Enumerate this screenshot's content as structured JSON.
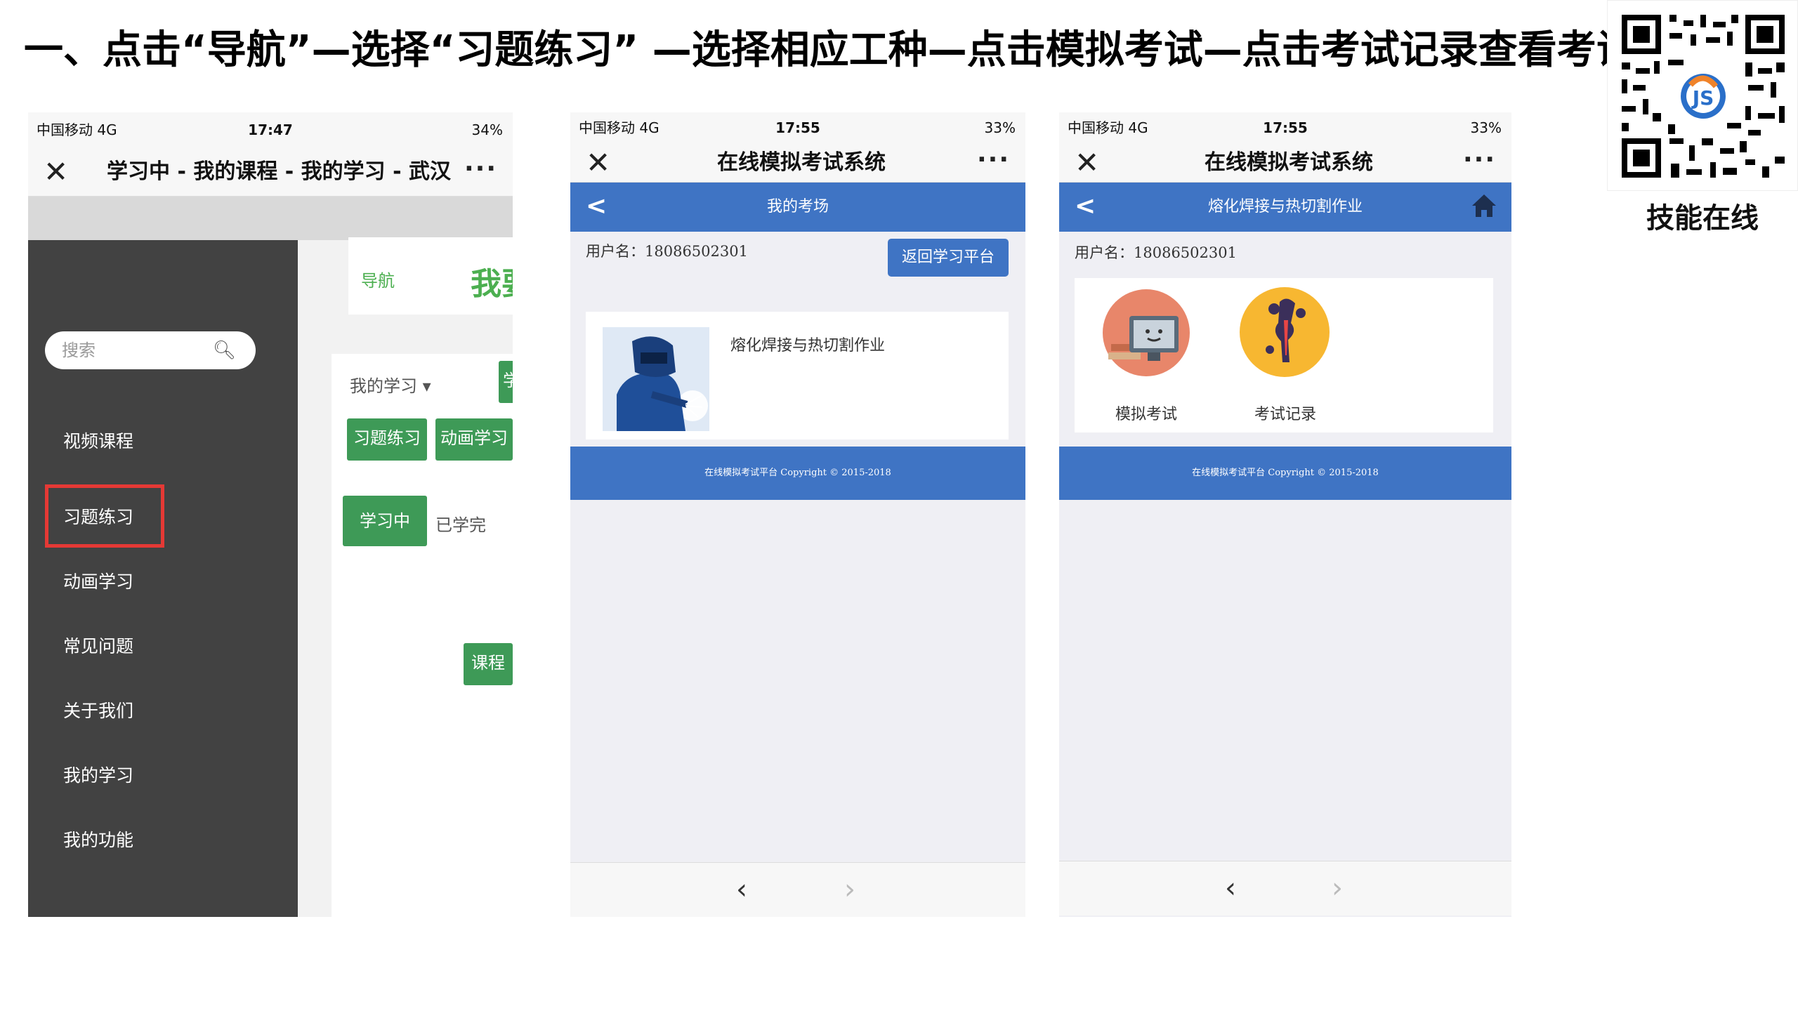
{
  "title": "一、点击“导航”—选择“习题练习” —选择相应工种—点击模拟考试—点击考试记录查看考试内容",
  "qr_caption": "技能在线",
  "phone1": {
    "status": {
      "carrier": "中国移动  4G",
      "time": "17:47",
      "battery": "34%"
    },
    "nav_title": "学习中 - 我的课程 - 我的学习 - 武汉",
    "search_placeholder": "搜索",
    "menu": [
      "视频课程",
      "习题练习",
      "动画学习",
      "常见问题",
      "关于我们",
      "我的学习",
      "我的功能"
    ],
    "content": {
      "nav_label": "导航",
      "big_text": "我要",
      "dropdown": "我的学习 ▾",
      "btn_study": "学习",
      "btn_practice": "习题练习",
      "btn_animation": "动画学习",
      "btn_learning": "学习中",
      "finished": "已学完",
      "btn_course": "课程"
    }
  },
  "phone2": {
    "status": {
      "carrier": "中国移动  4G",
      "time": "17:55",
      "battery": "33%"
    },
    "nav_title": "在线模拟考试系统",
    "bar_title": "我的考场",
    "username_label": "用户名：18086502301",
    "return_button": "返回学习平台",
    "exam_name": "熔化焊接与热切割作业",
    "footer": "在线模拟考试平台 Copyright © 2015-2018"
  },
  "phone3": {
    "status": {
      "carrier": "中国移动  4G",
      "time": "17:55",
      "battery": "33%"
    },
    "nav_title": "在线模拟考试系统",
    "bar_title": "熔化焊接与热切割作业",
    "username_label": "用户名：18086502301",
    "icon_mock": "模拟考试",
    "icon_records": "考试记录",
    "footer": "在线模拟考试平台 Copyright © 2015-2018"
  },
  "colors": {
    "accent_blue": "#3f74c4",
    "green": "#3e9a57",
    "highlight_red": "#e53935",
    "sidebar": "#424242"
  }
}
